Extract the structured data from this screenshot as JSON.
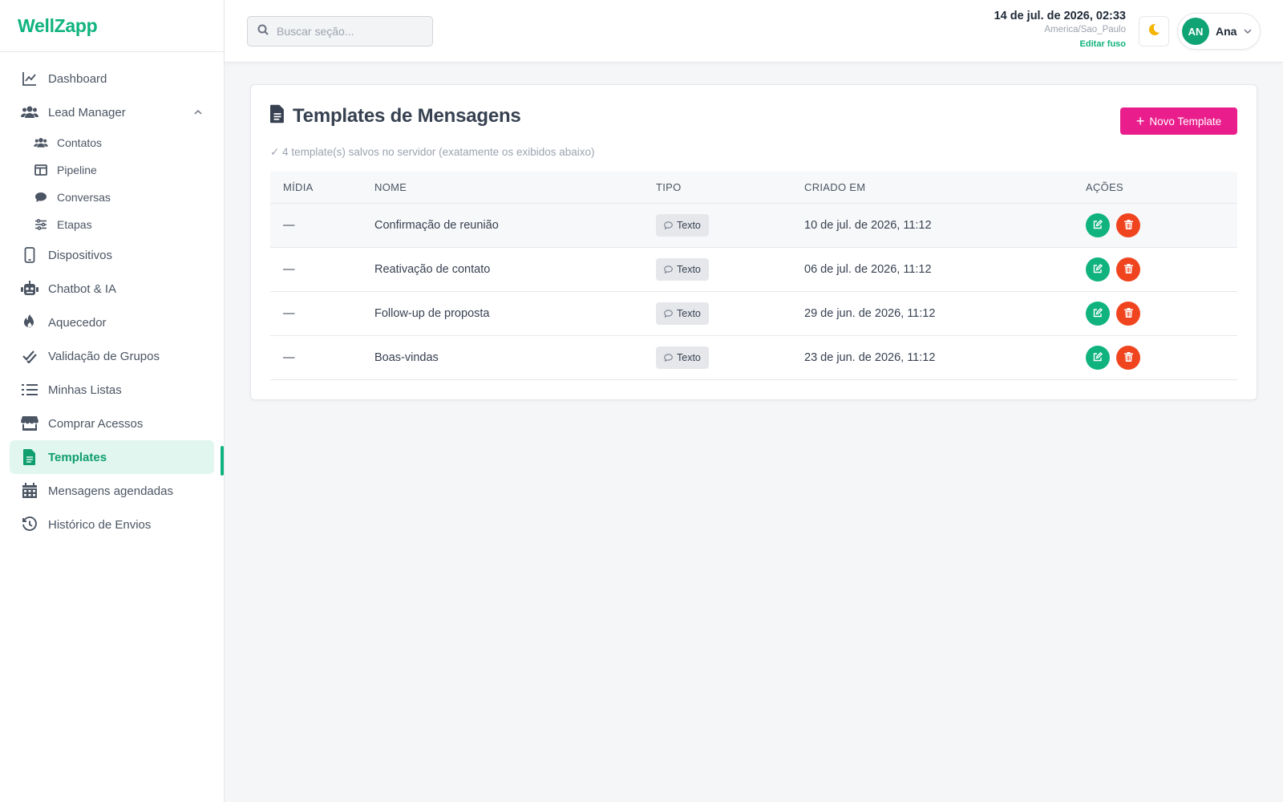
{
  "brand": {
    "name": "WellZapp",
    "color": "#10b37e"
  },
  "sidebar": {
    "items": [
      {
        "label": "Dashboard",
        "icon": "chart-line-icon"
      },
      {
        "label": "Lead Manager",
        "icon": "users-icon",
        "expanded": true,
        "children": [
          {
            "label": "Contatos",
            "icon": "users-icon"
          },
          {
            "label": "Pipeline",
            "icon": "columns-icon"
          },
          {
            "label": "Conversas",
            "icon": "chat-bubble-icon"
          },
          {
            "label": "Etapas",
            "icon": "sliders-icon"
          }
        ]
      },
      {
        "label": "Dispositivos",
        "icon": "mobile-icon"
      },
      {
        "label": "Chatbot & IA",
        "icon": "robot-icon"
      },
      {
        "label": "Aquecedor",
        "icon": "fire-icon"
      },
      {
        "label": "Validação de Grupos",
        "icon": "double-check-icon"
      },
      {
        "label": "Minhas Listas",
        "icon": "list-icon"
      },
      {
        "label": "Comprar Acessos",
        "icon": "store-icon"
      },
      {
        "label": "Templates",
        "icon": "file-icon",
        "active": true
      },
      {
        "label": "Mensagens agendadas",
        "icon": "calendar-icon"
      },
      {
        "label": "Histórico de Envios",
        "icon": "history-icon"
      }
    ]
  },
  "topbar": {
    "search_placeholder": "Buscar seção...",
    "datetime": "14 de jul. de 2026, 02:33",
    "timezone": "America/Sao_Paulo",
    "edit_timezone": "Editar fuso",
    "theme_icon": "moon-icon",
    "user": {
      "initials": "AN",
      "name": "Ana"
    }
  },
  "main": {
    "title": "Templates de Mensagens",
    "new_button": "Novo Template",
    "saved_note": "✓ 4 template(s) salvos no servidor (exatamente os exibidos abaixo)",
    "columns": [
      "MÍDIA",
      "NOME",
      "TIPO",
      "CRIADO EM",
      "AÇÕES"
    ],
    "rows": [
      {
        "media": "—",
        "name": "Confirmação de reunião",
        "type": "Texto",
        "created": "10 de jul. de 2026, 11:12"
      },
      {
        "media": "—",
        "name": "Reativação de contato",
        "type": "Texto",
        "created": "06 de jul. de 2026, 11:12"
      },
      {
        "media": "—",
        "name": "Follow-up de proposta",
        "type": "Texto",
        "created": "29 de jun. de 2026, 11:12"
      },
      {
        "media": "—",
        "name": "Boas-vindas",
        "type": "Texto",
        "created": "23 de jun. de 2026, 11:12"
      }
    ]
  },
  "colors": {
    "accent": "#10b37e",
    "primary_button": "#e91e8c",
    "edit": "#10b37e",
    "delete": "#f0441f"
  }
}
